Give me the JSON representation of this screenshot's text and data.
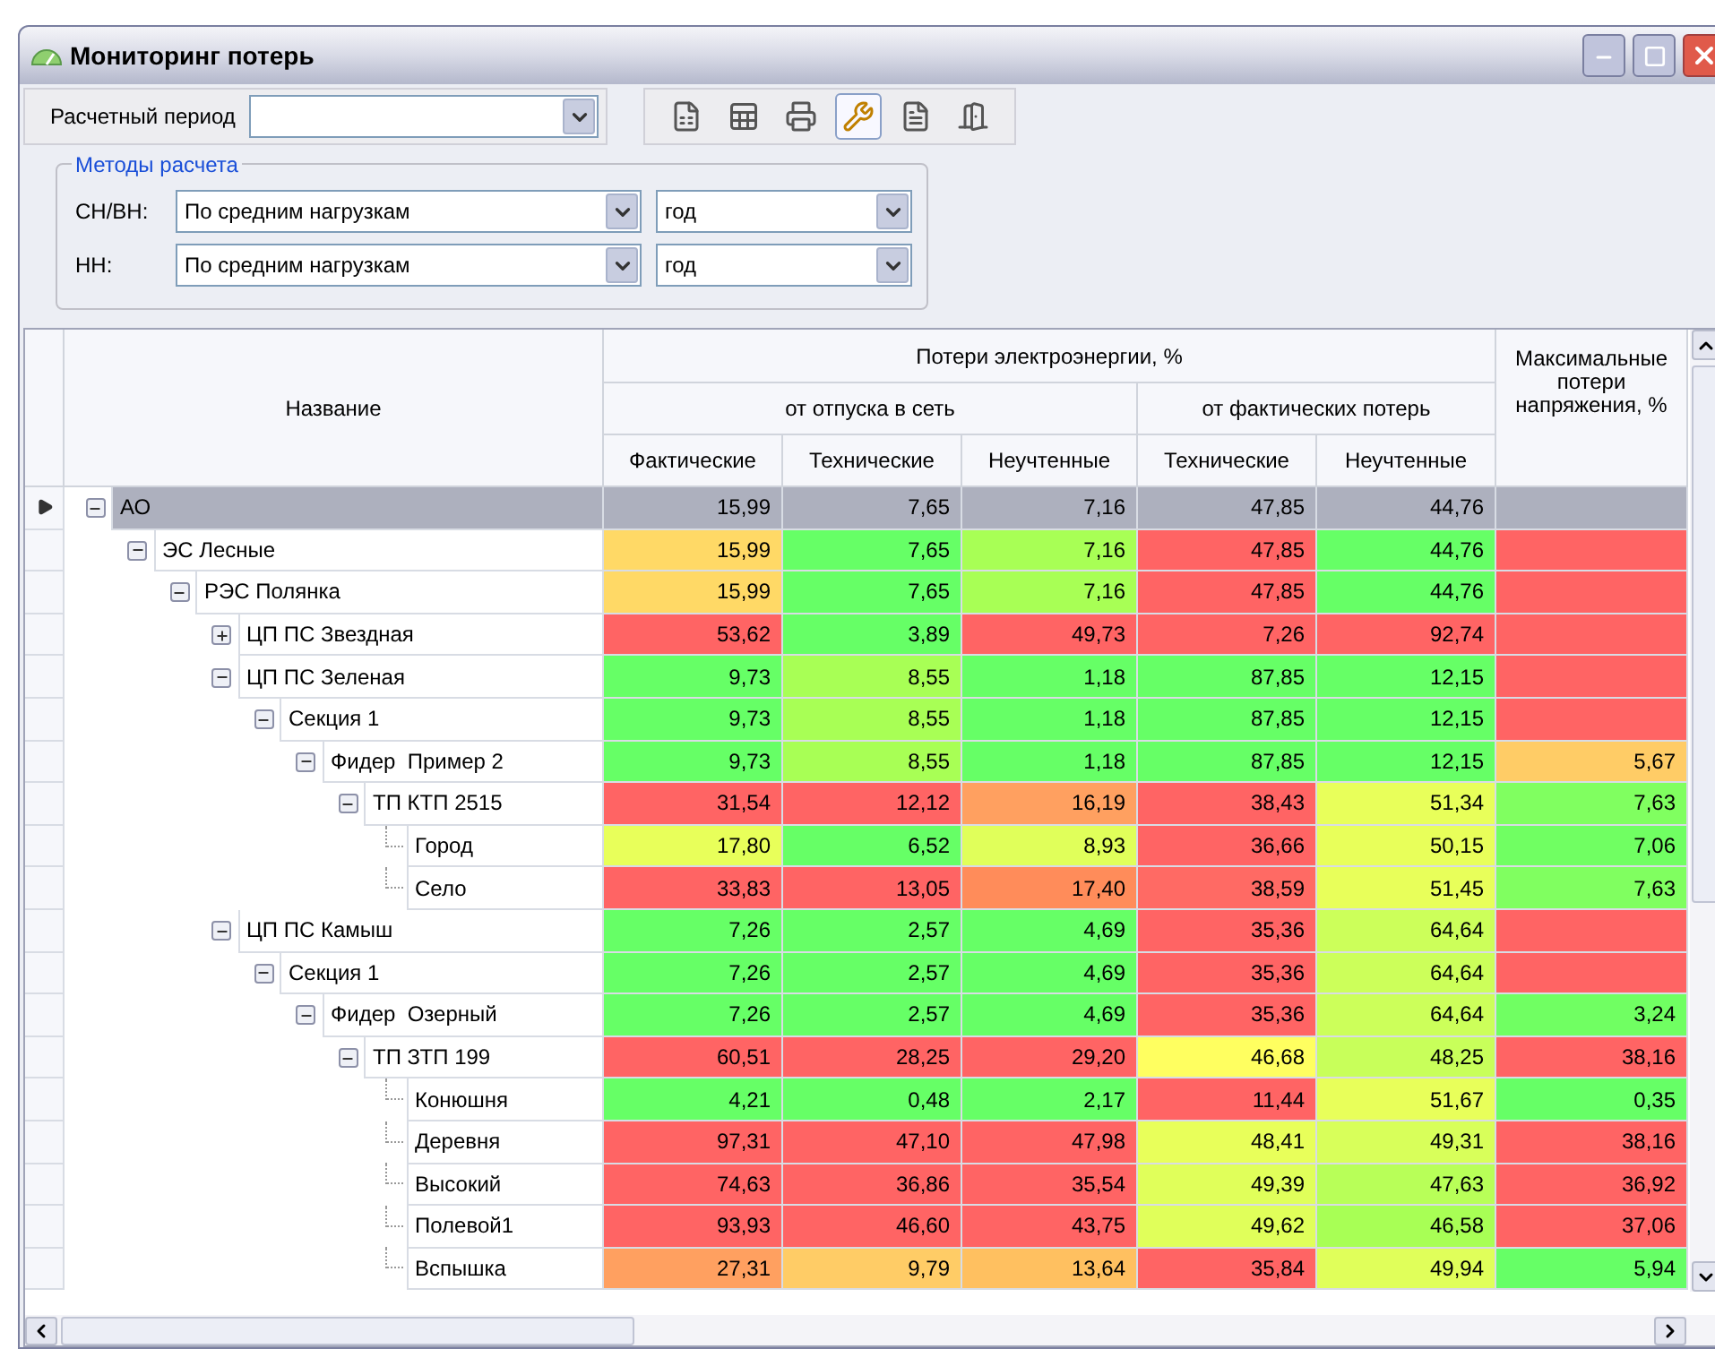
{
  "window": {
    "title": "Мониторинг потерь"
  },
  "toolbar": {
    "period_label": "Расчетный период",
    "buttons": [
      {
        "pressed": false
      },
      {
        "pressed": false
      },
      {
        "pressed": false
      },
      {
        "pressed": true
      },
      {
        "pressed": false
      },
      {
        "pressed": false
      }
    ]
  },
  "methods": {
    "title": "Методы расчета",
    "rows": [
      {
        "label": "СН/ВН:",
        "method": "По средним нагрузкам",
        "interval": "год"
      },
      {
        "label": "НН:",
        "method": "По средним нагрузкам",
        "interval": "год"
      }
    ]
  },
  "table": {
    "name_header": "Название",
    "group_header": "Потери электроэнергии, %",
    "subgroups": [
      {
        "label": "от отпуска в сеть",
        "columns": [
          "Фактические",
          "Технические",
          "Неучтенные"
        ]
      },
      {
        "label": "от фактических потерь",
        "columns": [
          "Технические",
          "Неучтенные"
        ]
      }
    ],
    "last_header": "Максимальные потери напряжения, %",
    "rows": [
      {
        "name": "АО",
        "selected": true,
        "expanded": true,
        "cells": [
          {
            "value": "15,99"
          },
          {
            "value": "7,65"
          },
          {
            "value": "7,16"
          },
          {
            "value": "47,85"
          },
          {
            "value": "44,76"
          },
          {}
        ],
        "children": [
          {
            "name": "ЭС Лесные",
            "selected": false,
            "expanded": true,
            "cells": [
              {
                "value": "15,99",
                "color": "#ffd966"
              },
              {
                "value": "7,65",
                "color": "#66ff66"
              },
              {
                "value": "7,16",
                "color": "#a8ff55"
              },
              {
                "value": "47,85",
                "color": "#ff6464"
              },
              {
                "value": "44,76",
                "color": "#66ff66"
              },
              {
                "color": "#ff6464"
              }
            ],
            "children": [
              {
                "name": "РЭС Полянка",
                "selected": false,
                "expanded": true,
                "cells": [
                  {
                    "value": "15,99",
                    "color": "#ffd966"
                  },
                  {
                    "value": "7,65",
                    "color": "#66ff66"
                  },
                  {
                    "value": "7,16",
                    "color": "#a8ff55"
                  },
                  {
                    "value": "47,85",
                    "color": "#ff6464"
                  },
                  {
                    "value": "44,76",
                    "color": "#66ff66"
                  },
                  {
                    "color": "#ff6464"
                  }
                ],
                "children": [
                  {
                    "name": "ЦП ПС Звездная",
                    "selected": false,
                    "expanded": false,
                    "cells": [
                      {
                        "value": "53,62",
                        "color": "#ff6464"
                      },
                      {
                        "value": "3,89",
                        "color": "#66ff66"
                      },
                      {
                        "value": "49,73",
                        "color": "#ff6464"
                      },
                      {
                        "value": "7,26",
                        "color": "#ff6464"
                      },
                      {
                        "value": "92,74",
                        "color": "#ff6464"
                      },
                      {
                        "color": "#ff6464"
                      }
                    ]
                  },
                  {
                    "name": "ЦП ПС Зеленая",
                    "selected": false,
                    "expanded": true,
                    "cells": [
                      {
                        "value": "9,73",
                        "color": "#66ff66"
                      },
                      {
                        "value": "8,55",
                        "color": "#a8ff55"
                      },
                      {
                        "value": "1,18",
                        "color": "#66ff66"
                      },
                      {
                        "value": "87,85",
                        "color": "#66ff66"
                      },
                      {
                        "value": "12,15",
                        "color": "#66ff66"
                      },
                      {
                        "color": "#ff6464"
                      }
                    ],
                    "children": [
                      {
                        "name": "Секция 1",
                        "selected": false,
                        "expanded": true,
                        "cells": [
                          {
                            "value": "9,73",
                            "color": "#66ff66"
                          },
                          {
                            "value": "8,55",
                            "color": "#a8ff55"
                          },
                          {
                            "value": "1,18",
                            "color": "#66ff66"
                          },
                          {
                            "value": "87,85",
                            "color": "#66ff66"
                          },
                          {
                            "value": "12,15",
                            "color": "#66ff66"
                          },
                          {
                            "color": "#ff6464"
                          }
                        ],
                        "children": [
                          {
                            "name": "Фидер  Пример 2",
                            "selected": false,
                            "expanded": true,
                            "cells": [
                              {
                                "value": "9,73",
                                "color": "#66ff66"
                              },
                              {
                                "value": "8,55",
                                "color": "#a8ff55"
                              },
                              {
                                "value": "1,18",
                                "color": "#66ff66"
                              },
                              {
                                "value": "87,85",
                                "color": "#66ff66"
                              },
                              {
                                "value": "12,15",
                                "color": "#66ff66"
                              },
                              {
                                "value": "5,67",
                                "color": "#ffcc66"
                              }
                            ],
                            "children": [
                              {
                                "name": "ТП КТП 2515",
                                "selected": false,
                                "expanded": true,
                                "cells": [
                                  {
                                    "value": "31,54",
                                    "color": "#ff6464"
                                  },
                                  {
                                    "value": "12,12",
                                    "color": "#ff6464"
                                  },
                                  {
                                    "value": "16,19",
                                    "color": "#ffa060"
                                  },
                                  {
                                    "value": "38,43",
                                    "color": "#ff6464"
                                  },
                                  {
                                    "value": "51,34",
                                    "color": "#e8ff5a"
                                  },
                                  {
                                    "value": "7,63",
                                    "color": "#80ff60"
                                  }
                                ],
                                "children": [
                                  {
                                    "name": "Город",
                                    "selected": false,
                                    "cells": [
                                      {
                                        "value": "17,80",
                                        "color": "#e8ff5a"
                                      },
                                      {
                                        "value": "6,52",
                                        "color": "#66ff66"
                                      },
                                      {
                                        "value": "8,93",
                                        "color": "#e0ff5a"
                                      },
                                      {
                                        "value": "36,66",
                                        "color": "#ff6464"
                                      },
                                      {
                                        "value": "50,15",
                                        "color": "#e8ff5a"
                                      },
                                      {
                                        "value": "7,06",
                                        "color": "#70ff62"
                                      }
                                    ]
                                  },
                                  {
                                    "name": "Село",
                                    "selected": false,
                                    "cells": [
                                      {
                                        "value": "33,83",
                                        "color": "#ff6464"
                                      },
                                      {
                                        "value": "13,05",
                                        "color": "#ff6464"
                                      },
                                      {
                                        "value": "17,40",
                                        "color": "#ff8c5a"
                                      },
                                      {
                                        "value": "38,59",
                                        "color": "#ff6a64"
                                      },
                                      {
                                        "value": "51,45",
                                        "color": "#e8ff5a"
                                      },
                                      {
                                        "value": "7,63",
                                        "color": "#80ff60"
                                      }
                                    ]
                                  }
                                ]
                              }
                            ]
                          }
                        ]
                      }
                    ]
                  },
                  {
                    "name": "ЦП ПС Камыш",
                    "selected": false,
                    "expanded": true,
                    "cells": [
                      {
                        "value": "7,26",
                        "color": "#66ff66"
                      },
                      {
                        "value": "2,57",
                        "color": "#66ff66"
                      },
                      {
                        "value": "4,69",
                        "color": "#66ff66"
                      },
                      {
                        "value": "35,36",
                        "color": "#ff6464"
                      },
                      {
                        "value": "64,64",
                        "color": "#ccff5a"
                      },
                      {
                        "color": "#ff6464"
                      }
                    ],
                    "children": [
                      {
                        "name": "Секция 1",
                        "selected": false,
                        "expanded": true,
                        "cells": [
                          {
                            "value": "7,26",
                            "color": "#66ff66"
                          },
                          {
                            "value": "2,57",
                            "color": "#66ff66"
                          },
                          {
                            "value": "4,69",
                            "color": "#66ff66"
                          },
                          {
                            "value": "35,36",
                            "color": "#ff6464"
                          },
                          {
                            "value": "64,64",
                            "color": "#ccff5a"
                          },
                          {
                            "color": "#ff6464"
                          }
                        ],
                        "children": [
                          {
                            "name": "Фидер  Озерный",
                            "selected": false,
                            "expanded": true,
                            "cells": [
                              {
                                "value": "7,26",
                                "color": "#66ff66"
                              },
                              {
                                "value": "2,57",
                                "color": "#66ff66"
                              },
                              {
                                "value": "4,69",
                                "color": "#66ff66"
                              },
                              {
                                "value": "35,36",
                                "color": "#ff6464"
                              },
                              {
                                "value": "64,64",
                                "color": "#ccff5a"
                              },
                              {
                                "value": "3,24",
                                "color": "#70ff62"
                              }
                            ],
                            "children": [
                              {
                                "name": "ТП ЗТП 199",
                                "selected": false,
                                "expanded": true,
                                "cells": [
                                  {
                                    "value": "60,51",
                                    "color": "#ff6464"
                                  },
                                  {
                                    "value": "28,25",
                                    "color": "#ff6464"
                                  },
                                  {
                                    "value": "29,20",
                                    "color": "#ff6464"
                                  },
                                  {
                                    "value": "46,68",
                                    "color": "#ffff60"
                                  },
                                  {
                                    "value": "48,25",
                                    "color": "#c8ff5a"
                                  },
                                  {
                                    "value": "38,16",
                                    "color": "#ff6464"
                                  }
                                ],
                                "children": [
                                  {
                                    "name": "Конюшня",
                                    "selected": false,
                                    "cells": [
                                      {
                                        "value": "4,21",
                                        "color": "#66ff66"
                                      },
                                      {
                                        "value": "0,48",
                                        "color": "#66ff66"
                                      },
                                      {
                                        "value": "2,17",
                                        "color": "#66ff66"
                                      },
                                      {
                                        "value": "11,44",
                                        "color": "#ff6464"
                                      },
                                      {
                                        "value": "51,67",
                                        "color": "#e8ff5a"
                                      },
                                      {
                                        "value": "0,35",
                                        "color": "#66ff66"
                                      }
                                    ]
                                  },
                                  {
                                    "name": "Деревня",
                                    "selected": false,
                                    "cells": [
                                      {
                                        "value": "97,31",
                                        "color": "#ff6464"
                                      },
                                      {
                                        "value": "47,10",
                                        "color": "#ff6464"
                                      },
                                      {
                                        "value": "47,98",
                                        "color": "#ff6464"
                                      },
                                      {
                                        "value": "48,41",
                                        "color": "#e8ff5a"
                                      },
                                      {
                                        "value": "49,31",
                                        "color": "#d8ff5a"
                                      },
                                      {
                                        "value": "38,16",
                                        "color": "#ff6464"
                                      }
                                    ]
                                  },
                                  {
                                    "name": "Высокий",
                                    "selected": false,
                                    "cells": [
                                      {
                                        "value": "74,63",
                                        "color": "#ff6464"
                                      },
                                      {
                                        "value": "36,86",
                                        "color": "#ff6464"
                                      },
                                      {
                                        "value": "35,54",
                                        "color": "#ff6464"
                                      },
                                      {
                                        "value": "49,39",
                                        "color": "#e0ff5a"
                                      },
                                      {
                                        "value": "47,63",
                                        "color": "#b8ff58"
                                      },
                                      {
                                        "value": "36,92",
                                        "color": "#ff6464"
                                      }
                                    ]
                                  },
                                  {
                                    "name": "Полевой1",
                                    "selected": false,
                                    "cells": [
                                      {
                                        "value": "93,93",
                                        "color": "#ff6464"
                                      },
                                      {
                                        "value": "46,60",
                                        "color": "#ff6464"
                                      },
                                      {
                                        "value": "43,75",
                                        "color": "#ff6464"
                                      },
                                      {
                                        "value": "49,62",
                                        "color": "#e0ff5a"
                                      },
                                      {
                                        "value": "46,58",
                                        "color": "#a8ff55"
                                      },
                                      {
                                        "value": "37,06",
                                        "color": "#ff6464"
                                      }
                                    ]
                                  },
                                  {
                                    "name": "Вспышка",
                                    "selected": false,
                                    "cells": [
                                      {
                                        "value": "27,31",
                                        "color": "#ffa060"
                                      },
                                      {
                                        "value": "9,79",
                                        "color": "#ffcc66"
                                      },
                                      {
                                        "value": "13,64",
                                        "color": "#ffc060"
                                      },
                                      {
                                        "value": "35,84",
                                        "color": "#ff6464"
                                      },
                                      {
                                        "value": "49,94",
                                        "color": "#e0ff5a"
                                      },
                                      {
                                        "value": "5,94",
                                        "color": "#66ff66"
                                      }
                                    ]
                                  }
                                ]
                              }
                            ]
                          }
                        ]
                      }
                    ]
                  }
                ]
              }
            ]
          }
        ]
      }
    ]
  }
}
